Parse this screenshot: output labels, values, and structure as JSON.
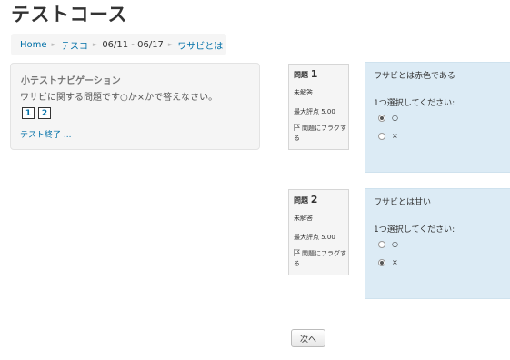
{
  "page": {
    "title": "テストコース"
  },
  "breadcrumb": {
    "home": "Home",
    "course": "テスコ",
    "section": "06/11 - 06/17",
    "quiz": "ワサビとは",
    "separator": "►"
  },
  "quiz_nav": {
    "title": "小テストナビゲーション",
    "description": "ワサビに関する問題です○か×かで答えなさい。",
    "buttons": [
      "1",
      "2"
    ],
    "finish_link": "テスト終了 ..."
  },
  "questions": [
    {
      "label": "問題",
      "number": "1",
      "state": "未解答",
      "grade": "最大評点 5.00",
      "flag": "問題にフラグする",
      "text": "ワサビとは赤色である",
      "prompt": "1つ選択してください:",
      "options": [
        {
          "label": "○",
          "checked": true
        },
        {
          "label": "×",
          "checked": false
        }
      ]
    },
    {
      "label": "問題",
      "number": "2",
      "state": "未解答",
      "grade": "最大評点 5.00",
      "flag": "問題にフラグする",
      "text": "ワサビとは甘い",
      "prompt": "1つ選択してください:",
      "options": [
        {
          "label": "○",
          "checked": false
        },
        {
          "label": "×",
          "checked": true
        }
      ]
    }
  ],
  "next_button": "次へ",
  "colors": {
    "link": "#0070a8",
    "question_bg": "#dcebf5",
    "info_bg": "#f5f5f5"
  }
}
